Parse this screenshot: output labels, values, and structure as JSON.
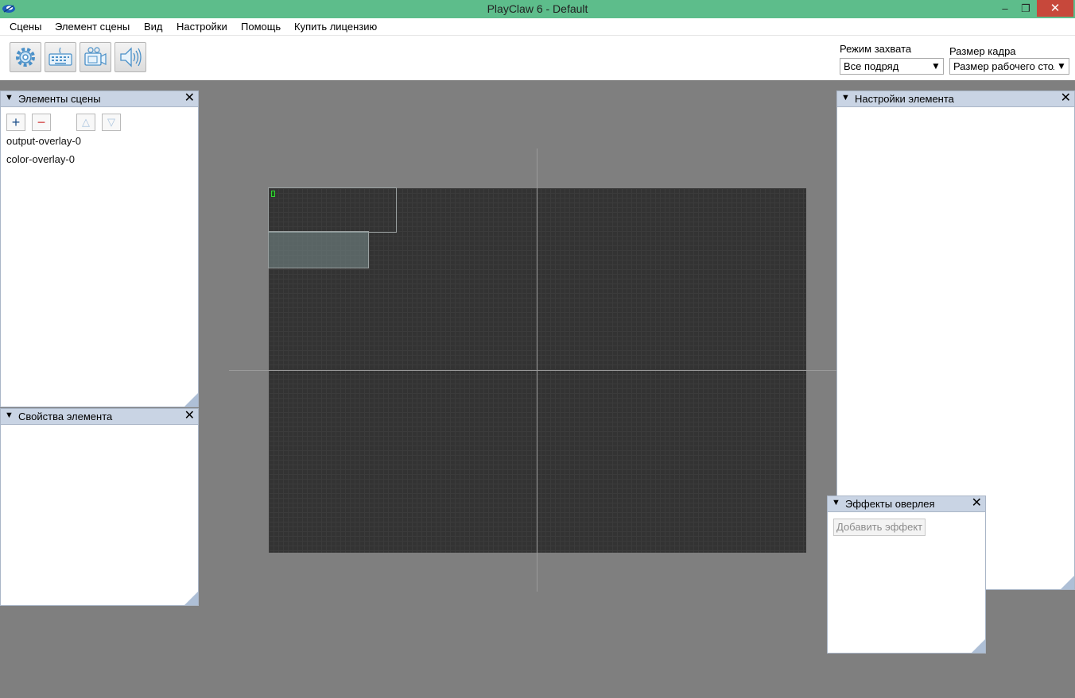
{
  "window": {
    "title": "PlayClaw 6 - Default",
    "minimize": "–",
    "maximize": "❐",
    "close": "✕"
  },
  "menu": [
    "Сцены",
    "Элемент сцены",
    "Вид",
    "Настройки",
    "Помощь",
    "Купить лицензию"
  ],
  "toolbar": {
    "buttons": [
      "gear-icon",
      "keyboard-icon",
      "camera-icon",
      "speaker-icon"
    ],
    "capture_mode": {
      "label": "Режим захвата",
      "value": "Все подряд"
    },
    "frame_size": {
      "label": "Размер кадра",
      "value": "Размер рабочего стола"
    },
    "dropdown_arrow": "▼"
  },
  "scene_elements": {
    "title": "Элементы сцены",
    "items": [
      "output-overlay-0",
      "color-overlay-0"
    ],
    "add": "+",
    "remove": "−",
    "up": "△",
    "down": "▽"
  },
  "element_properties": {
    "title": "Свойства элемента"
  },
  "element_settings": {
    "title": "Настройки элемента"
  },
  "overlay_effects": {
    "title": "Эффекты оверлея",
    "add_effect": "Добавить эффект"
  },
  "common": {
    "collapse": "▼",
    "close": "✕"
  },
  "colors": {
    "titlebar": "#5dbd8b",
    "panel_header": "#c9d4e4",
    "background": "#7f7f7f",
    "canvas": "#333333"
  }
}
